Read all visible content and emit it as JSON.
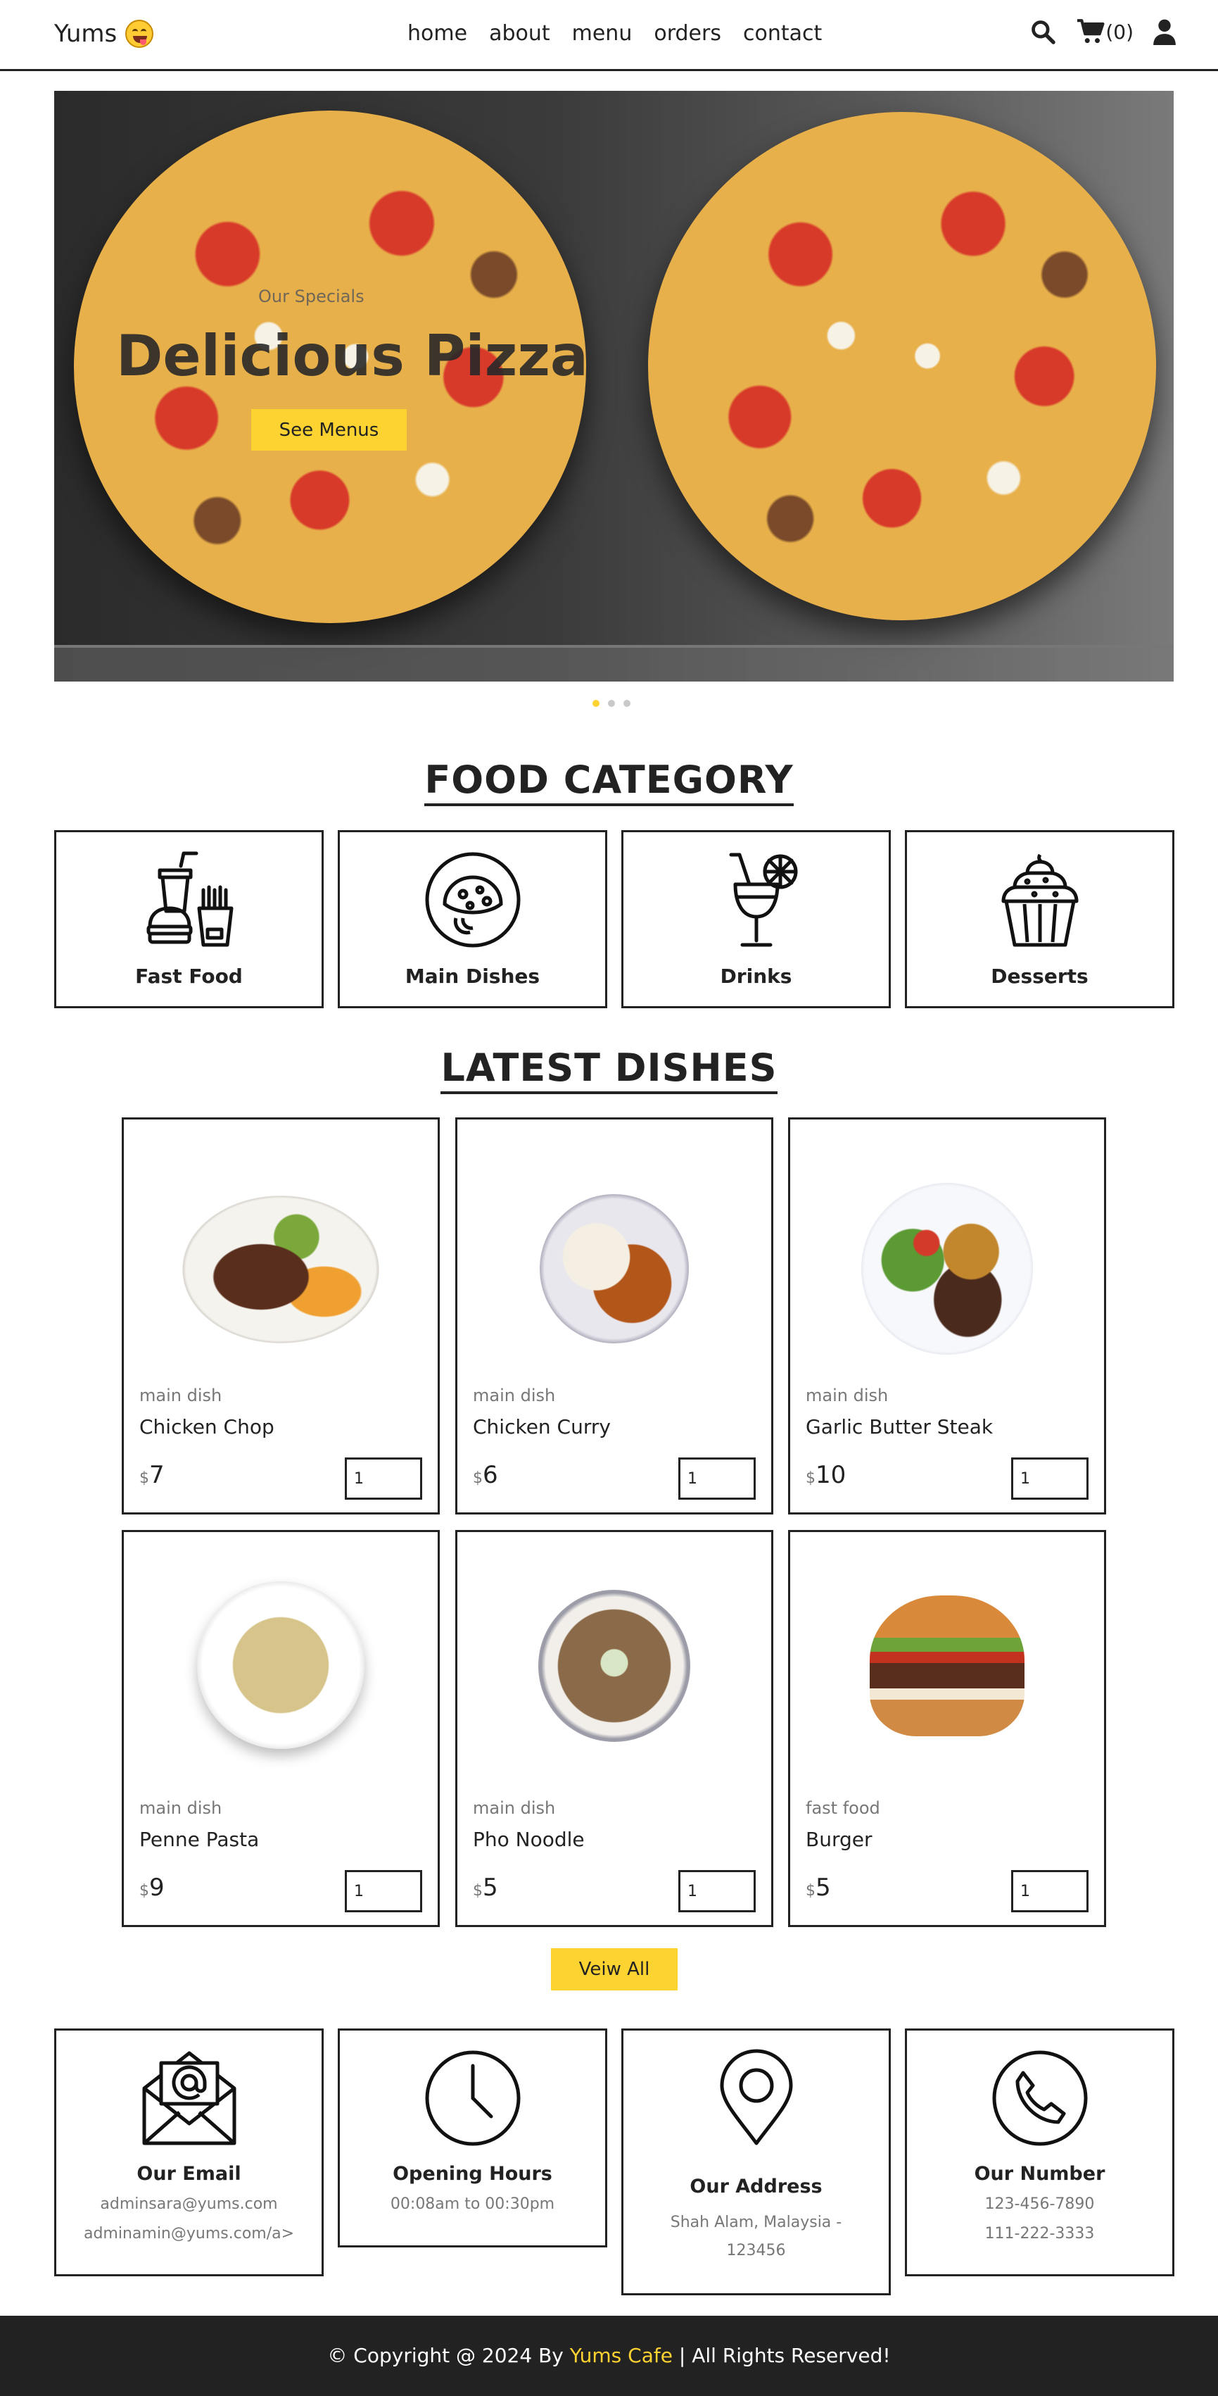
{
  "header": {
    "logo_text": "Yums",
    "nav": [
      "home",
      "about",
      "menu",
      "orders",
      "contact"
    ],
    "cart_count": "(0)",
    "icons": [
      "search-icon",
      "cart-icon",
      "user-icon"
    ]
  },
  "hero": {
    "subtitle": "Our Specials",
    "title": "Delicious Pizza",
    "button": "See Menus",
    "slides": 3,
    "active_slide": 1
  },
  "food_category": {
    "title": "FOOD CATEGORY",
    "items": [
      {
        "label": "Fast Food",
        "icon": "fast-food-icon"
      },
      {
        "label": "Main Dishes",
        "icon": "main-dish-icon"
      },
      {
        "label": "Drinks",
        "icon": "drink-icon"
      },
      {
        "label": "Desserts",
        "icon": "cupcake-icon"
      }
    ]
  },
  "latest_dishes": {
    "title": "LATEST DISHES",
    "currency": "$",
    "items": [
      {
        "category": "main dish",
        "name": "Chicken Chop",
        "price": "7",
        "qty": "1"
      },
      {
        "category": "main dish",
        "name": "Chicken Curry",
        "price": "6",
        "qty": "1"
      },
      {
        "category": "main dish",
        "name": "Garlic Butter Steak",
        "price": "10",
        "qty": "1"
      },
      {
        "category": "main dish",
        "name": "Penne Pasta",
        "price": "9",
        "qty": "1"
      },
      {
        "category": "main dish",
        "name": "Pho Noodle",
        "price": "5",
        "qty": "1"
      },
      {
        "category": "fast food",
        "name": "Burger",
        "price": "5",
        "qty": "1"
      }
    ],
    "view_all": "Veiw All"
  },
  "info": [
    {
      "title": "Our Email",
      "lines": [
        "adminsara@yums.com",
        "adminamin@yums.com/a>"
      ],
      "icon": "email-icon"
    },
    {
      "title": "Opening Hours",
      "lines": [
        "00:08am to 00:30pm"
      ],
      "icon": "clock-icon"
    },
    {
      "title": "Our Address",
      "lines": [
        "Shah Alam, Malaysia -",
        "123456"
      ],
      "icon": "location-icon"
    },
    {
      "title": "Our Number",
      "lines": [
        "123-456-7890",
        "111-222-3333"
      ],
      "icon": "phone-icon"
    }
  ],
  "footer": {
    "prefix": "© Copyright @ 2024 By ",
    "brand": "Yums Cafe",
    "suffix": " | All Rights Reserved!"
  },
  "colors": {
    "accent": "#fdd331",
    "dark": "#222222",
    "muted": "#777777"
  }
}
